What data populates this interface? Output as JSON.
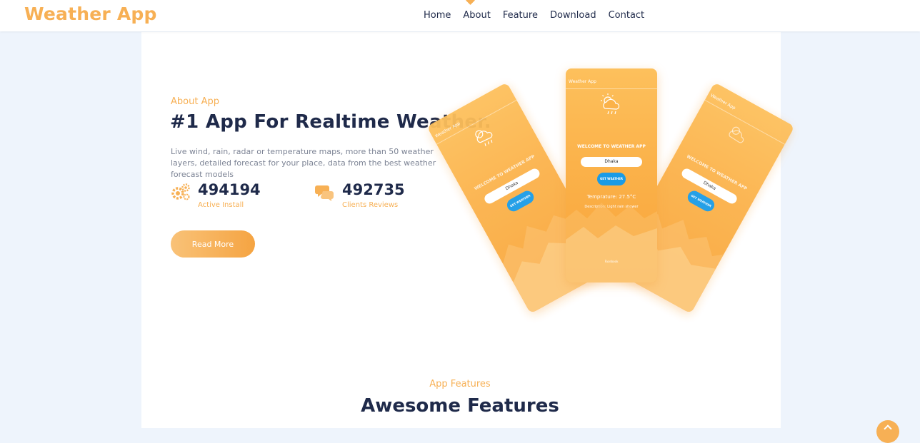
{
  "header": {
    "logo": "Weather App",
    "nav": [
      {
        "label": "Home"
      },
      {
        "label": "About"
      },
      {
        "label": "Feature"
      },
      {
        "label": "Download"
      },
      {
        "label": "Contact"
      }
    ]
  },
  "about": {
    "label": "About App",
    "title": "#1 App For Realtime Weather.",
    "description": "Live wind, rain, radar or temperature maps, more than 50 weather layers, detailed forecast for your place, data from the best weather forecast models",
    "stats": [
      {
        "value": "494194",
        "label": "Active Install",
        "icon": "gears-icon"
      },
      {
        "value": "492735",
        "label": "Clients Reviews",
        "icon": "chat-bubbles-icon"
      }
    ],
    "button_label": "Read More"
  },
  "phone": {
    "app_title": "Weather App",
    "welcome": "WELCOME TO WEATHER APP",
    "city": "Dhaka",
    "button": "GET WEATHER",
    "temperature": "Temprature: 27.5°C",
    "description": "Description: Light rain shower",
    "footer": "Facebook"
  },
  "features": {
    "label": "App Features",
    "title": "Awesome Features"
  },
  "colors": {
    "accent": "#f7b055",
    "dark": "#1f2a4a",
    "background": "#eef4fc"
  }
}
